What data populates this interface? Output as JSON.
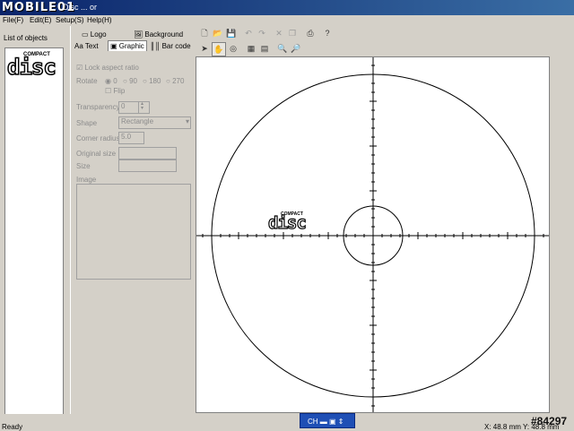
{
  "app": {
    "brand": "MOBILE01",
    "window_title": "Disc ... or"
  },
  "menu": [
    {
      "label": "File(F)"
    },
    {
      "label": "Edit(E)"
    },
    {
      "label": "Setup(S)"
    },
    {
      "label": "Help(H)"
    }
  ],
  "objects_panel": {
    "title": "List of objects",
    "logo_top": "COMPACT",
    "logo_main": "disc"
  },
  "tabs_row1": [
    {
      "label": "Logo"
    },
    {
      "label": "Background"
    }
  ],
  "tabs_row2": [
    {
      "label": "Text"
    },
    {
      "label": "Graphic"
    },
    {
      "label": "Bar code"
    }
  ],
  "graphic_props": {
    "lock_aspect": "Lock aspect ratio",
    "rotate_label": "Rotate",
    "rotate_options": [
      "0",
      "90",
      "180",
      "270"
    ],
    "flip": "Flip",
    "transparency_label": "Transparency",
    "transparency_value": "0",
    "shape_label": "Shape",
    "shape_value": "Rectangle",
    "corner_label": "Corner radius",
    "corner_value": "5.0",
    "original_size_label": "Original size",
    "size_label": "Size",
    "image_label": "Image"
  },
  "canvas": {
    "logo_top": "COMPACT",
    "logo_main": "disc"
  },
  "statusbar": {
    "status": "Ready",
    "ime_label": "CH",
    "coords": "X: 48.8 mm  Y: 48.8 mm",
    "watermark": "#84297"
  }
}
